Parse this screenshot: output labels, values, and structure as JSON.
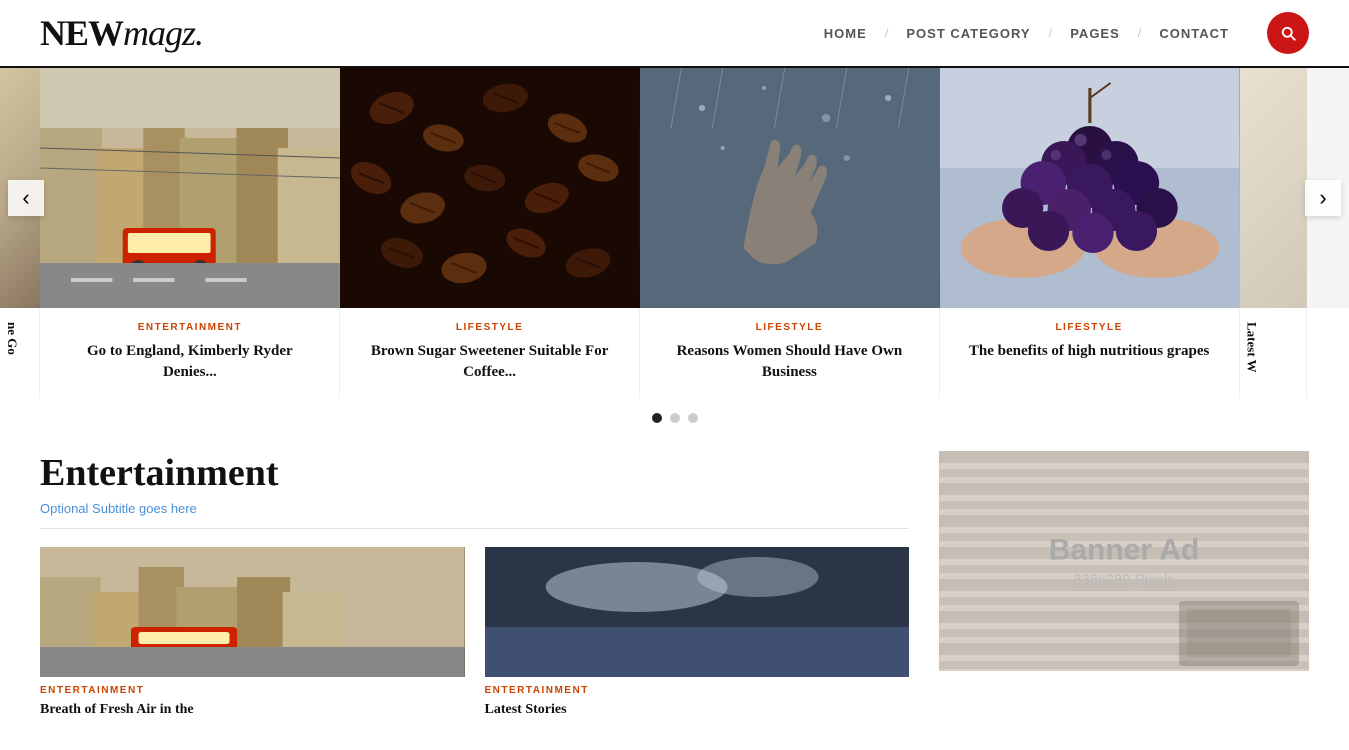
{
  "header": {
    "logo_text": "NEW",
    "logo_italic": "magz.",
    "nav": [
      {
        "label": "HOME",
        "id": "home"
      },
      {
        "label": "POST CATEGORY",
        "id": "post-category"
      },
      {
        "label": "PAGES",
        "id": "pages"
      },
      {
        "label": "CONTACT",
        "id": "contact"
      }
    ]
  },
  "carousel": {
    "prev_label": "‹",
    "next_label": "›",
    "slides": [
      {
        "id": "slide-partial-left",
        "partial": "left",
        "category": "",
        "title": "ne Go"
      },
      {
        "id": "slide-city",
        "category": "ENTERTAINMENT",
        "title": "Go to England, Kimberly Ryder Denies..."
      },
      {
        "id": "slide-coffee",
        "category": "LIFESTYLE",
        "title": "Brown Sugar Sweetener Suitable For Coffee..."
      },
      {
        "id": "slide-rain",
        "category": "LIFESTYLE",
        "title": "Reasons Women Should Have Own Business"
      },
      {
        "id": "slide-grapes",
        "category": "LIFESTYLE",
        "title": "The benefits of high nutritious grapes"
      },
      {
        "id": "slide-partial-right",
        "partial": "right",
        "category": "",
        "title": "Latest W"
      }
    ],
    "dots": [
      {
        "state": "active"
      },
      {
        "state": "inactive"
      },
      {
        "state": "inactive"
      }
    ]
  },
  "entertainment_section": {
    "title": "Entertainment",
    "subtitle_plain": "Optional ",
    "subtitle_link": "Subtitle goes here",
    "articles": [
      {
        "category": "ENTERTAINMENT",
        "title": "Breath of Fresh Air in the"
      },
      {
        "category": "ENTERTAINMENT",
        "title": "Latest Stories"
      }
    ]
  },
  "sidebar": {
    "banner_title": "Banner Ad",
    "banner_sub": "336x280 Pixels"
  }
}
